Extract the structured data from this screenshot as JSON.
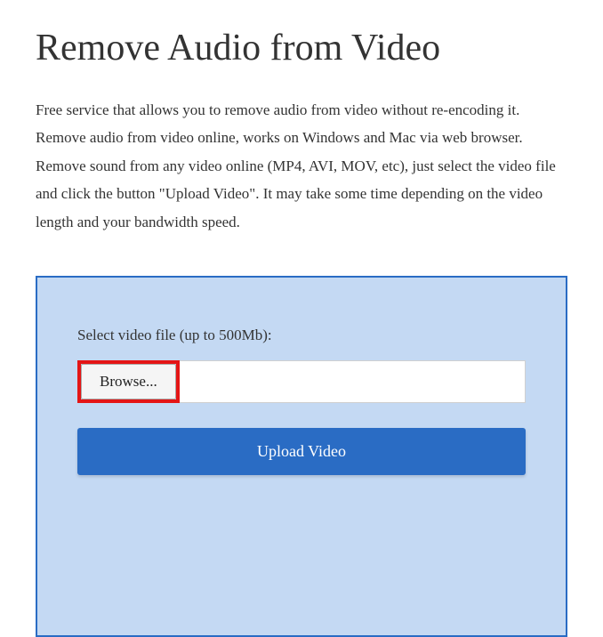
{
  "header": {
    "title": "Remove Audio from Video"
  },
  "description": "Free service that allows you to remove audio from video without re-encoding it. Remove audio from video online, works on Windows and Mac via web browser. Remove sound from any video online (MP4, AVI, MOV, etc), just select the video file and click the button \"Upload Video\". It may take some time depending on the video length and your bandwidth speed.",
  "form": {
    "select_label": "Select video file (up to 500Mb):",
    "browse_label": "Browse...",
    "file_value": "",
    "upload_label": "Upload Video"
  }
}
